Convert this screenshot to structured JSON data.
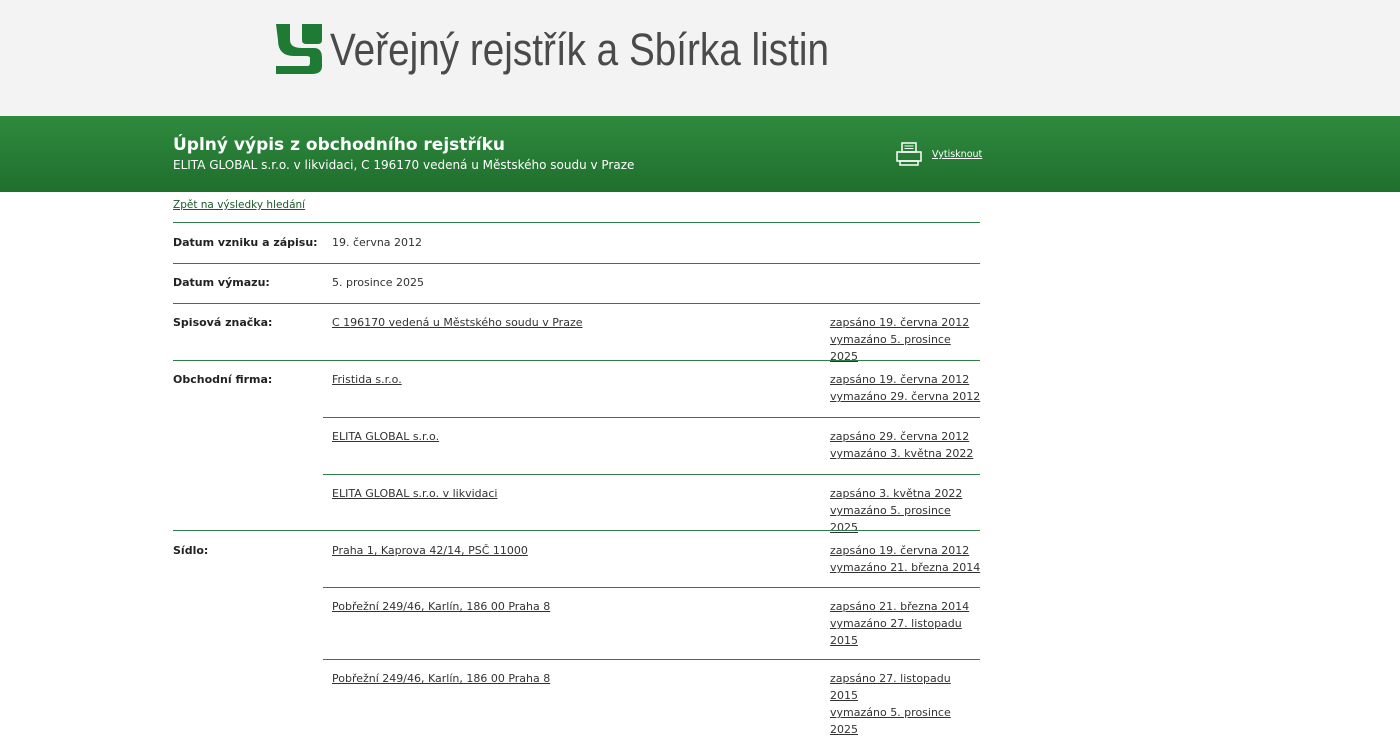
{
  "header": {
    "logo_text": "Veřejný rejstřík a Sbírka listin",
    "title": "Úplný výpis z obchodního rejstříku",
    "subtitle": "ELITA GLOBAL s.r.o. v likvidaci, C 196170 vedená u Městského soudu v Praze",
    "print_label": "Vytisknout"
  },
  "nav": {
    "back_label": "Zpět na výsledky hledání"
  },
  "colors": {
    "brand_green": "#1f6f2d",
    "header_bg": "#f3f3f3"
  },
  "rows": {
    "datum_vzniku": {
      "label": "Datum vzniku a zápisu:",
      "value": "19. června 2012"
    },
    "datum_vymazu": {
      "label": "Datum výmazu:",
      "value": "5. prosince 2025"
    },
    "spisova_znacka": {
      "label": "Spisová značka:",
      "value": "C 196170 vedená u Městského soudu v Praze",
      "zapsano": "zapsáno 19. června 2012",
      "vymazano": "vymazáno 5. prosince 2025"
    },
    "obchodni_firma": {
      "label": "Obchodní firma:",
      "entries": [
        {
          "value": "Fristida s.r.o.",
          "zapsano": "zapsáno 19. června 2012",
          "vymazano": "vymazáno 29. června 2012"
        },
        {
          "value": "ELITA GLOBAL s.r.o.",
          "zapsano": "zapsáno 29. června 2012",
          "vymazano": "vymazáno 3. května 2022"
        },
        {
          "value": "ELITA GLOBAL s.r.o. v likvidaci",
          "zapsano": "zapsáno 3. května 2022",
          "vymazano": "vymazáno 5. prosince 2025"
        }
      ]
    },
    "sidlo": {
      "label": "Sídlo:",
      "entries": [
        {
          "value": "Praha 1, Kaprova 42/14, PSČ 11000",
          "zapsano": "zapsáno 19. června 2012",
          "vymazano": "vymazáno 21. března 2014"
        },
        {
          "value": "Pobřežní 249/46, Karlín, 186 00 Praha 8",
          "zapsano": "zapsáno 21. března 2014",
          "vymazano": "vymazáno 27. listopadu 2015"
        },
        {
          "value": "Pobřežní 249/46, Karlín, 186 00 Praha 8",
          "zapsano": "zapsáno 27. listopadu 2015",
          "vymazano": "vymazáno 5. prosince 2025"
        }
      ]
    }
  }
}
